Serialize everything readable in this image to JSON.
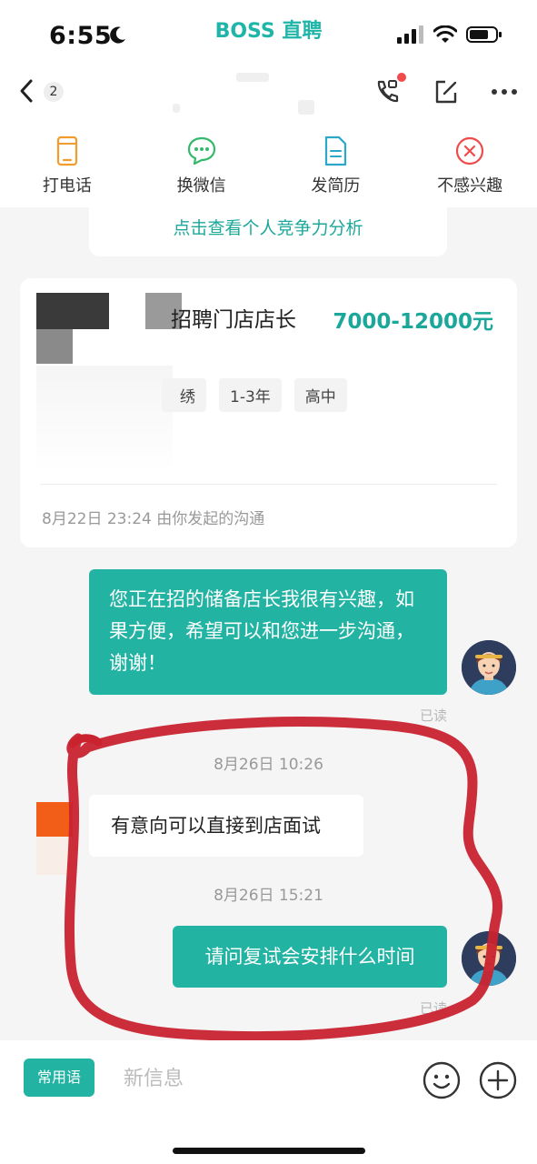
{
  "status_bar": {
    "time": "6:55",
    "brand": "BOSS 直聘"
  },
  "header": {
    "unread_count": "2"
  },
  "actions": [
    {
      "label": "打电话",
      "icon": "phone-icon"
    },
    {
      "label": "换微信",
      "icon": "wechat-icon"
    },
    {
      "label": "发简历",
      "icon": "resume-icon"
    },
    {
      "label": "不感兴趣",
      "icon": "not-interested-icon"
    }
  ],
  "colors": {
    "accent": "#22b3a3",
    "text_accent": "#1ba89b",
    "danger": "#f04a4a",
    "annotation": "#c8232f"
  },
  "banner": {
    "text": "点击查看个人竞争力分析"
  },
  "job": {
    "title": "招聘门店店长",
    "salary": "7000-12000元",
    "tags": [
      "绣",
      "1-3年",
      "高中"
    ],
    "meta": "8月22日 23:24 由你发起的沟通"
  },
  "messages": {
    "m1": {
      "text": "您正在招的储备店长我很有兴趣，如果方便，希望可以和您进一步沟通，谢谢！",
      "status": "已读"
    },
    "t1": "8月26日 10:26",
    "m2": {
      "text": "有意向可以直接到店面试"
    },
    "t2": "8月26日 15:21",
    "m3": {
      "text": "请问复试会安排什么时间",
      "status": "已读"
    }
  },
  "input_bar": {
    "phrase_label": "常用语",
    "placeholder": "新信息"
  }
}
